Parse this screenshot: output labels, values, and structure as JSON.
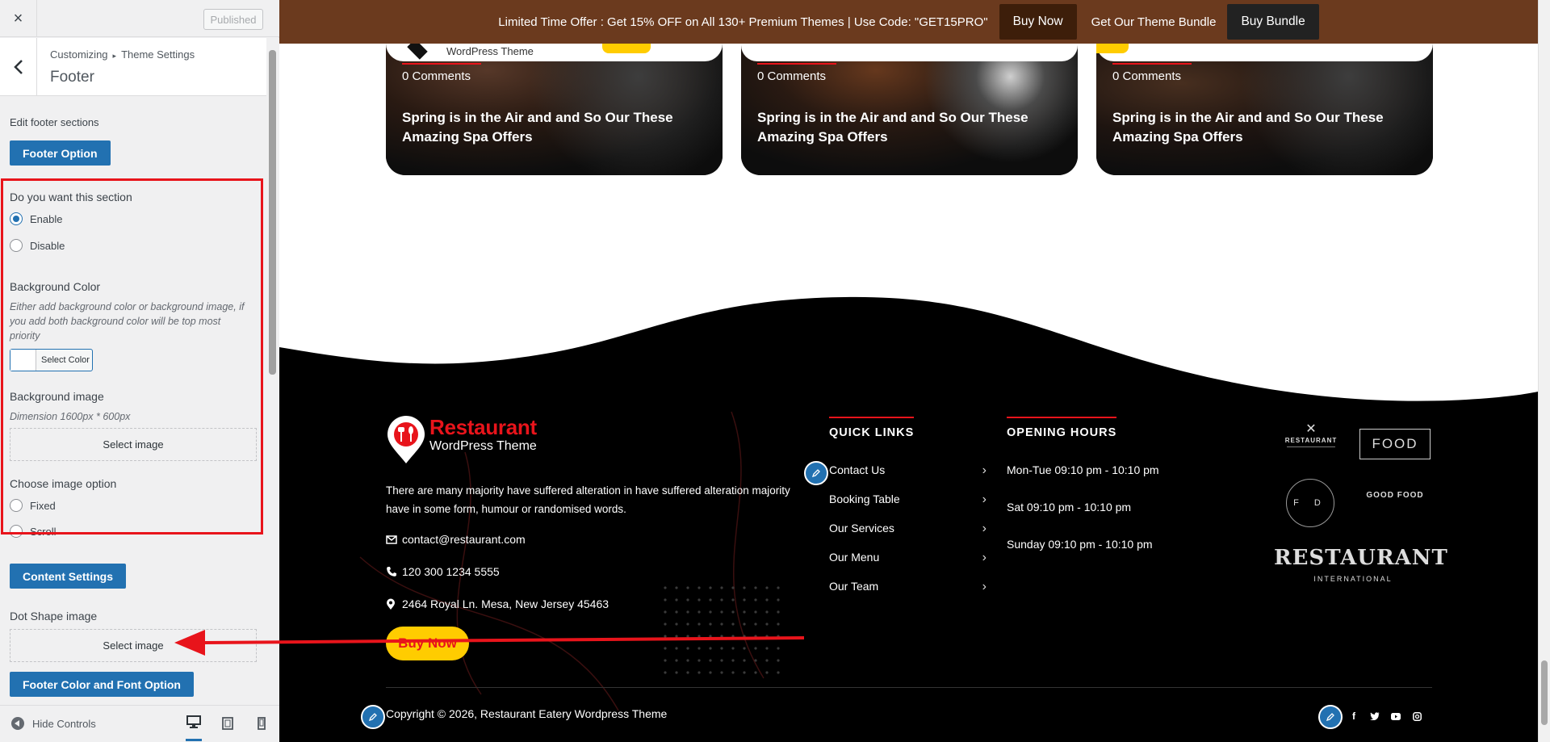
{
  "customizer": {
    "close_label": "×",
    "publish_label": "Published",
    "breadcrumb": {
      "parent": "Customizing",
      "separator": "▸",
      "child": "Theme Settings"
    },
    "section_title": "Footer",
    "edit_label": "Edit footer sections",
    "footer_option_button": "Footer Option",
    "section_toggle": {
      "label": "Do you want this section",
      "options": [
        {
          "label": "Enable",
          "checked": true
        },
        {
          "label": "Disable",
          "checked": false
        }
      ]
    },
    "background_color": {
      "label": "Background Color",
      "description": "Either add background color or background image, if you add both background color will be top most priority",
      "button": "Select Color"
    },
    "background_image": {
      "label": "Background image",
      "dimension": "Dimension 1600px * 600px",
      "button": "Select image"
    },
    "image_option": {
      "label": "Choose image option",
      "options": [
        {
          "label": "Fixed",
          "checked": false
        },
        {
          "label": "Scroll",
          "checked": false
        }
      ]
    },
    "content_settings_button": "Content Settings",
    "dot_shape": {
      "label": "Dot Shape image",
      "button": "Select image"
    },
    "color_font_button": "Footer Color and Font Option",
    "hide_controls": "Hide Controls",
    "devices": [
      "desktop-icon",
      "tablet-icon",
      "mobile-icon"
    ],
    "accent_color": "#2271b1",
    "highlight_color": "#e8141b"
  },
  "preview": {
    "promo": {
      "text": "Limited Time Offer : Get 15% OFF on All 130+ Premium Themes | Use Code: \"GET15PRO\"",
      "buy_now": "Buy Now",
      "bundle_text": "Get Our Theme Bundle",
      "buy_bundle": "Buy Bundle",
      "bg_color": "#6b3a1e"
    },
    "cards": [
      {
        "comments": "0 Comments",
        "title": "Spring is in the Air and and So Our These Amazing Spa Offers"
      },
      {
        "comments": "0 Comments",
        "title": "Spring is in the Air and and So Our These Amazing Spa Offers"
      },
      {
        "comments": "0 Comments",
        "title": "Spring is in the Air and and So Our These Amazing Spa Offers"
      }
    ],
    "partial_header_text": "WordPress Theme",
    "footer": {
      "brand": "Restaurant",
      "tagline": "WordPress Theme",
      "about": "There are many majority have suffered alteration in have suffered alteration majority have in some form, humour or randomised words.",
      "email": "contact@restaurant.com",
      "phone": "120 300 1234 5555",
      "address": "2464 Royal Ln. Mesa, New Jersey 45463",
      "buy_now": "Buy Now",
      "quick_links_heading": "QUICK LINKS",
      "quick_links": [
        "Contact Us",
        "Booking Table",
        "Our Services",
        "Our Menu",
        "Our Team"
      ],
      "opening_hours_heading": "OPENING HOURS",
      "opening_hours": [
        "Mon-Tue 09:10 pm - 10:10 pm",
        "Sat 09:10 pm - 10:10 pm",
        "Sunday 09:10 pm - 10:10 pm"
      ],
      "copyright": "Copyright © 2026, Restaurant Eatery Wordpress Theme",
      "badges": {
        "restaurant_small": "RESTAURANT",
        "food": "FOOD",
        "fd": "F D",
        "good_food": "GOOD FOOD",
        "restaurant_big": "RESTAURANT",
        "international": "INTERNATIONAL"
      },
      "social": [
        "facebook-icon",
        "twitter-icon",
        "youtube-icon",
        "instagram-icon"
      ]
    }
  }
}
